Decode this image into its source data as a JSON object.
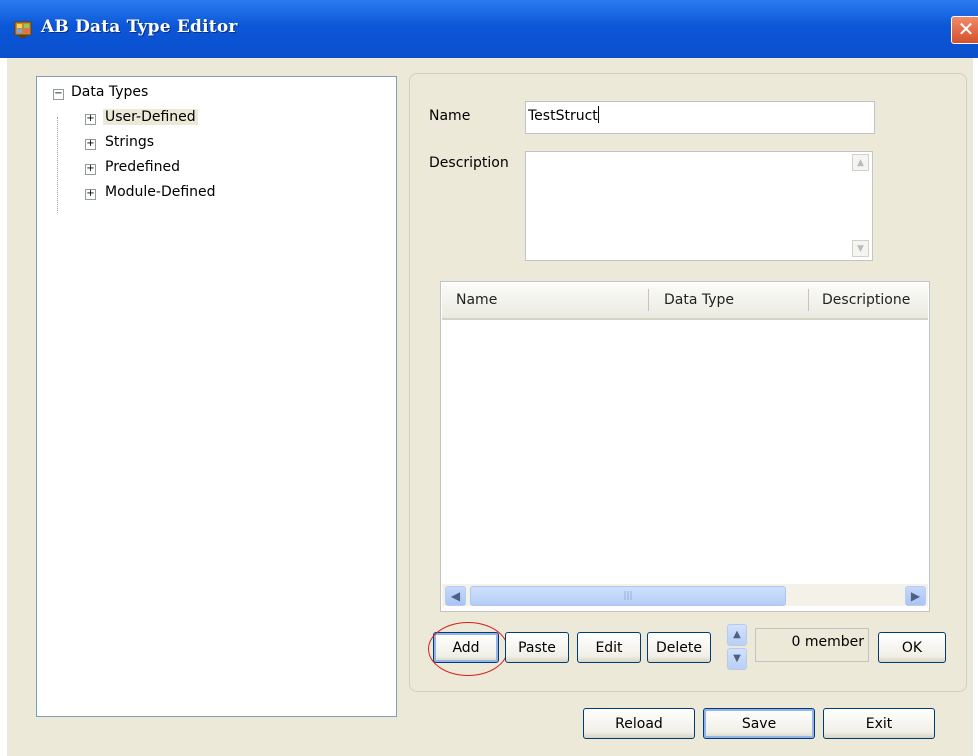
{
  "window": {
    "title": "AB Data Type Editor",
    "close_glyph": "✕"
  },
  "tree": {
    "root": {
      "label": "Data Types",
      "expander": "−"
    },
    "children": [
      {
        "label": "User-Defined",
        "expander": "+"
      },
      {
        "label": "Strings",
        "expander": "+"
      },
      {
        "label": "Predefined",
        "expander": "+"
      },
      {
        "label": "Module-Defined",
        "expander": "+"
      }
    ]
  },
  "form": {
    "name_label": "Name",
    "name_value": "TestStruct",
    "description_label": "Description",
    "description_value": ""
  },
  "members_grid": {
    "columns": [
      "Name",
      "Data Type",
      "Descriptione"
    ],
    "rows": []
  },
  "grid_buttons": {
    "add": "Add",
    "paste": "Paste",
    "edit": "Edit",
    "delete": "Delete",
    "member_count": "0 member",
    "ok": "OK"
  },
  "footer_buttons": {
    "reload": "Reload",
    "save": "Save",
    "exit": "Exit"
  },
  "icons": {
    "app": "app-icon",
    "close": "close-icon",
    "scroll_up": "▲",
    "scroll_down": "▼",
    "scroll_left": "◀",
    "scroll_right": "▶",
    "thumb_grip": "|||"
  },
  "colors": {
    "titlebar": "#0b57d8",
    "dialog_bg": "#ece9d8",
    "highlight_ring": "#d42020"
  }
}
